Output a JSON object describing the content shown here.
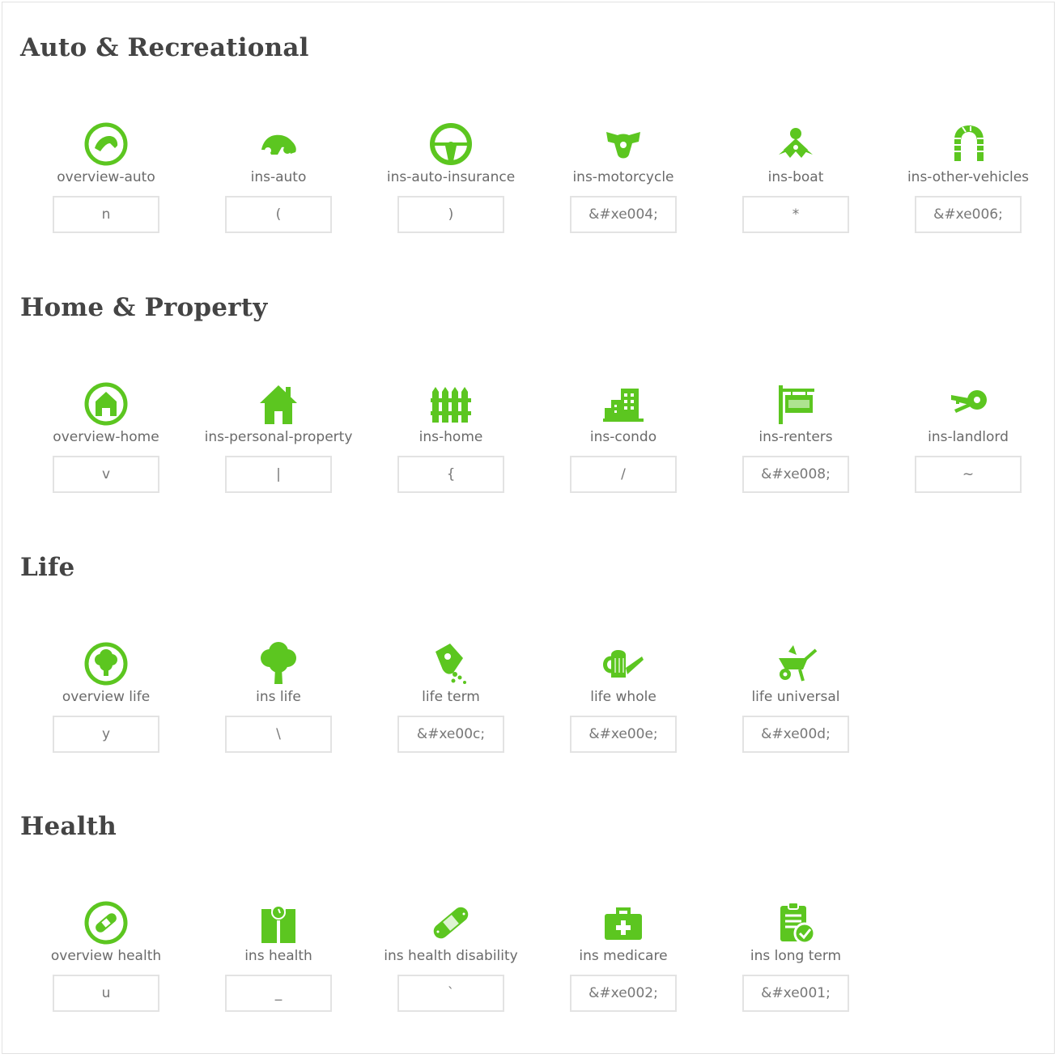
{
  "accent_color": "#5cc620",
  "sections": [
    {
      "title": "Auto & Recreational",
      "items": [
        {
          "label": "overview-auto",
          "code": "n",
          "icon": "overview-auto-icon"
        },
        {
          "label": "ins-auto",
          "code": "(",
          "icon": "car-icon"
        },
        {
          "label": "ins-auto-insurance",
          "code": ")",
          "icon": "steering-wheel-icon"
        },
        {
          "label": "ins-motorcycle",
          "code": "&#xe004;",
          "icon": "motorcycle-icon"
        },
        {
          "label": "ins-boat",
          "code": "*",
          "icon": "boat-icon"
        },
        {
          "label": "ins-other-vehicles",
          "code": "&#xe006;",
          "icon": "tire-icon"
        }
      ]
    },
    {
      "title": "Home & Property",
      "items": [
        {
          "label": "overview-home",
          "code": "v",
          "icon": "overview-home-icon"
        },
        {
          "label": "ins-personal-property",
          "code": "|",
          "icon": "house-icon"
        },
        {
          "label": "ins-home",
          "code": "{",
          "icon": "fence-icon"
        },
        {
          "label": "ins-condo",
          "code": "/",
          "icon": "buildings-icon"
        },
        {
          "label": "ins-renters",
          "code": "&#xe008;",
          "icon": "sign-icon"
        },
        {
          "label": "ins-landlord",
          "code": "~",
          "icon": "key-icon"
        }
      ]
    },
    {
      "title": "Life",
      "items": [
        {
          "label": "overview life",
          "code": "y",
          "icon": "overview-life-icon"
        },
        {
          "label": "ins life",
          "code": "\\",
          "icon": "tree-icon"
        },
        {
          "label": "life term",
          "code": "&#xe00c;",
          "icon": "seed-bag-icon"
        },
        {
          "label": "life whole",
          "code": "&#xe00e;",
          "icon": "watering-can-icon"
        },
        {
          "label": "life universal",
          "code": "&#xe00d;",
          "icon": "wheelbarrow-icon"
        }
      ]
    },
    {
      "title": "Health",
      "items": [
        {
          "label": "overview health",
          "code": "u",
          "icon": "overview-health-icon"
        },
        {
          "label": "ins health",
          "code": "_",
          "icon": "scale-icon"
        },
        {
          "label": "ins health disability",
          "code": "`",
          "icon": "bandage-icon"
        },
        {
          "label": "ins medicare",
          "code": "&#xe002;",
          "icon": "medical-kit-icon"
        },
        {
          "label": "ins long term",
          "code": "&#xe001;",
          "icon": "clipboard-check-icon"
        }
      ]
    }
  ]
}
